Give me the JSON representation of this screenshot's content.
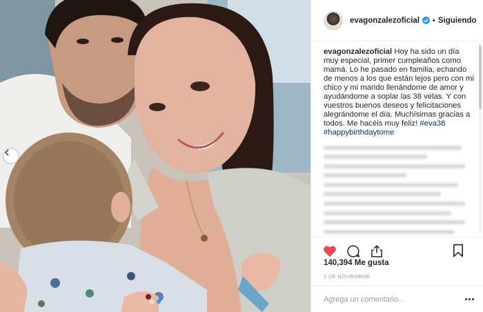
{
  "post": {
    "username": "evagonzalezoficial",
    "separator": "•",
    "follow_status": "Siguiendo",
    "caption_user": "evagonzalezoficial",
    "caption_text": "Hoy ha sido un día muy especial, primer cumpleaños como mamá. Lo he pasado en familia, echando de menos a los que están lejos pero con mi chico y mi marido llenándome de amor y ayudándome a soplar las 38 velas. Y con vuestros buenos deseos y felicitaciones alegrándome el día. Muchísimas gracias a todos. Me hacéis muy feliz! ",
    "hashtags": [
      "#eva38",
      "#happybirthdaytome"
    ],
    "likes": "140,394 Me gusta",
    "date": "5 DE NOVIEMBRE",
    "comment_placeholder": "Agrega un comentario..."
  },
  "carousel": {
    "slide_count": 2,
    "active_slide": 1
  },
  "icons": {
    "verified": "verified-badge-icon",
    "like": "heart-icon",
    "comment": "comment-icon",
    "share": "share-icon",
    "save": "bookmark-icon",
    "more": "more-options-icon",
    "prev": "chevron-left-icon"
  },
  "colors": {
    "like_red": "#ed4956",
    "verified_blue": "#3897f0",
    "hashtag": "#003569",
    "active_dot": "#3897f0"
  }
}
